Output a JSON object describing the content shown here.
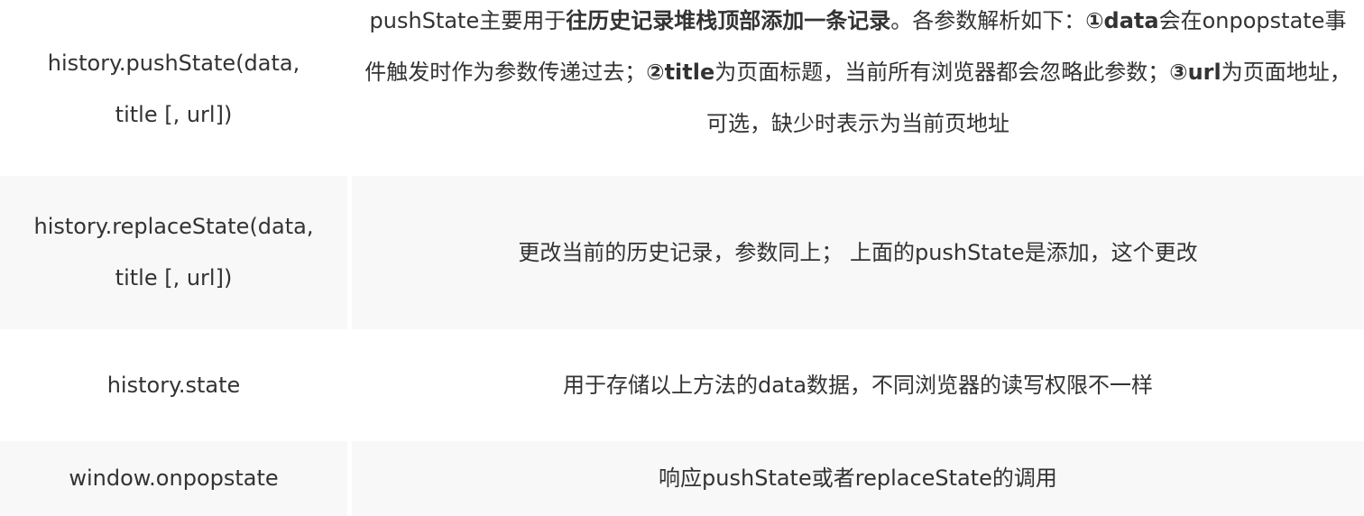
{
  "table": {
    "rows": [
      {
        "method": "history.pushState(data, title [, url])",
        "description_parts": [
          {
            "text": "pushState主要用于",
            "bold": false
          },
          {
            "text": "往历史记录堆栈顶部添加一条记录",
            "bold": true
          },
          {
            "text": "。各参数解析如下：",
            "bold": false
          },
          {
            "text": "①data",
            "bold": true
          },
          {
            "text": "会在onpopstate事件触发时作为参数传递过去；",
            "bold": false
          },
          {
            "text": "②title",
            "bold": true
          },
          {
            "text": "为页面标题，当前所有浏览器都会忽略此参数；",
            "bold": false
          },
          {
            "text": "③url",
            "bold": true
          },
          {
            "text": "为页面地址，可选，缺少时表示为当前页地址",
            "bold": false
          }
        ]
      },
      {
        "method": "history.replaceState(data, title [, url])",
        "description": "更改当前的历史记录，参数同上； 上面的pushState是添加，这个更改"
      },
      {
        "method": "history.state",
        "description": "用于存储以上方法的data数据，不同浏览器的读写权限不一样"
      },
      {
        "method": "window.onpopstate",
        "description": "响应pushState或者replaceState的调用"
      }
    ]
  }
}
